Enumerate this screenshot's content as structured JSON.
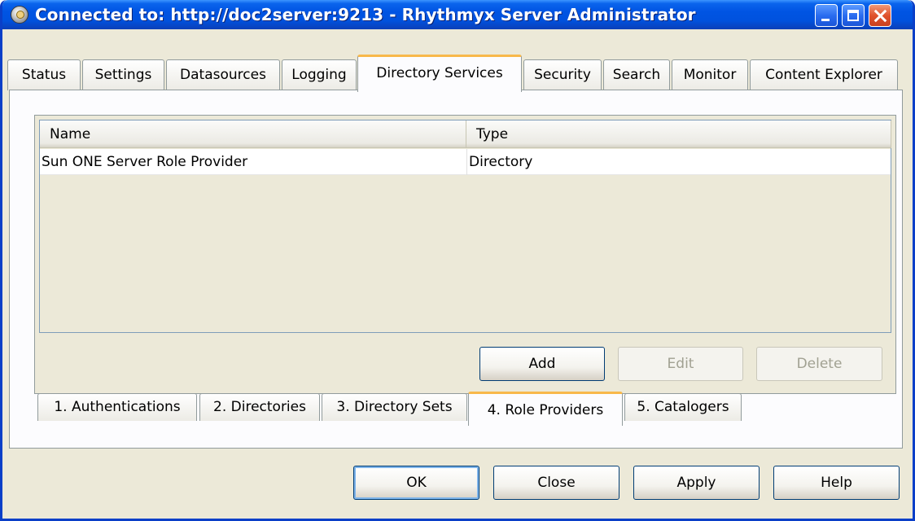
{
  "window": {
    "title": "Connected to: http://doc2server:9213 - Rhythmyx Server Administrator",
    "icon": "server-admin-icon"
  },
  "main_tabs": [
    {
      "label": "Status",
      "selected": false
    },
    {
      "label": "Settings",
      "selected": false
    },
    {
      "label": "Datasources",
      "selected": false
    },
    {
      "label": "Logging",
      "selected": false
    },
    {
      "label": "Directory Services",
      "selected": true
    },
    {
      "label": "Security",
      "selected": false
    },
    {
      "label": "Search",
      "selected": false
    },
    {
      "label": "Monitor",
      "selected": false
    },
    {
      "label": "Content Explorer",
      "selected": false
    }
  ],
  "table": {
    "columns": [
      "Name",
      "Type"
    ],
    "rows": [
      {
        "name": "Sun ONE Server Role Provider",
        "type": "Directory"
      }
    ]
  },
  "panel_buttons": {
    "add": "Add",
    "edit": "Edit",
    "delete": "Delete"
  },
  "sub_tabs": [
    {
      "label": "1. Authentications",
      "selected": false
    },
    {
      "label": "2. Directories",
      "selected": false
    },
    {
      "label": "3. Directory Sets",
      "selected": false
    },
    {
      "label": "4. Role Providers",
      "selected": true
    },
    {
      "label": "5. Catalogers",
      "selected": false
    }
  ],
  "dialog_buttons": {
    "ok": "OK",
    "close": "Close",
    "apply": "Apply",
    "help": "Help"
  },
  "colors": {
    "titlebar": "#0054e3",
    "tab_highlight": "#f8b84a",
    "window_bg": "#ece9d8"
  }
}
